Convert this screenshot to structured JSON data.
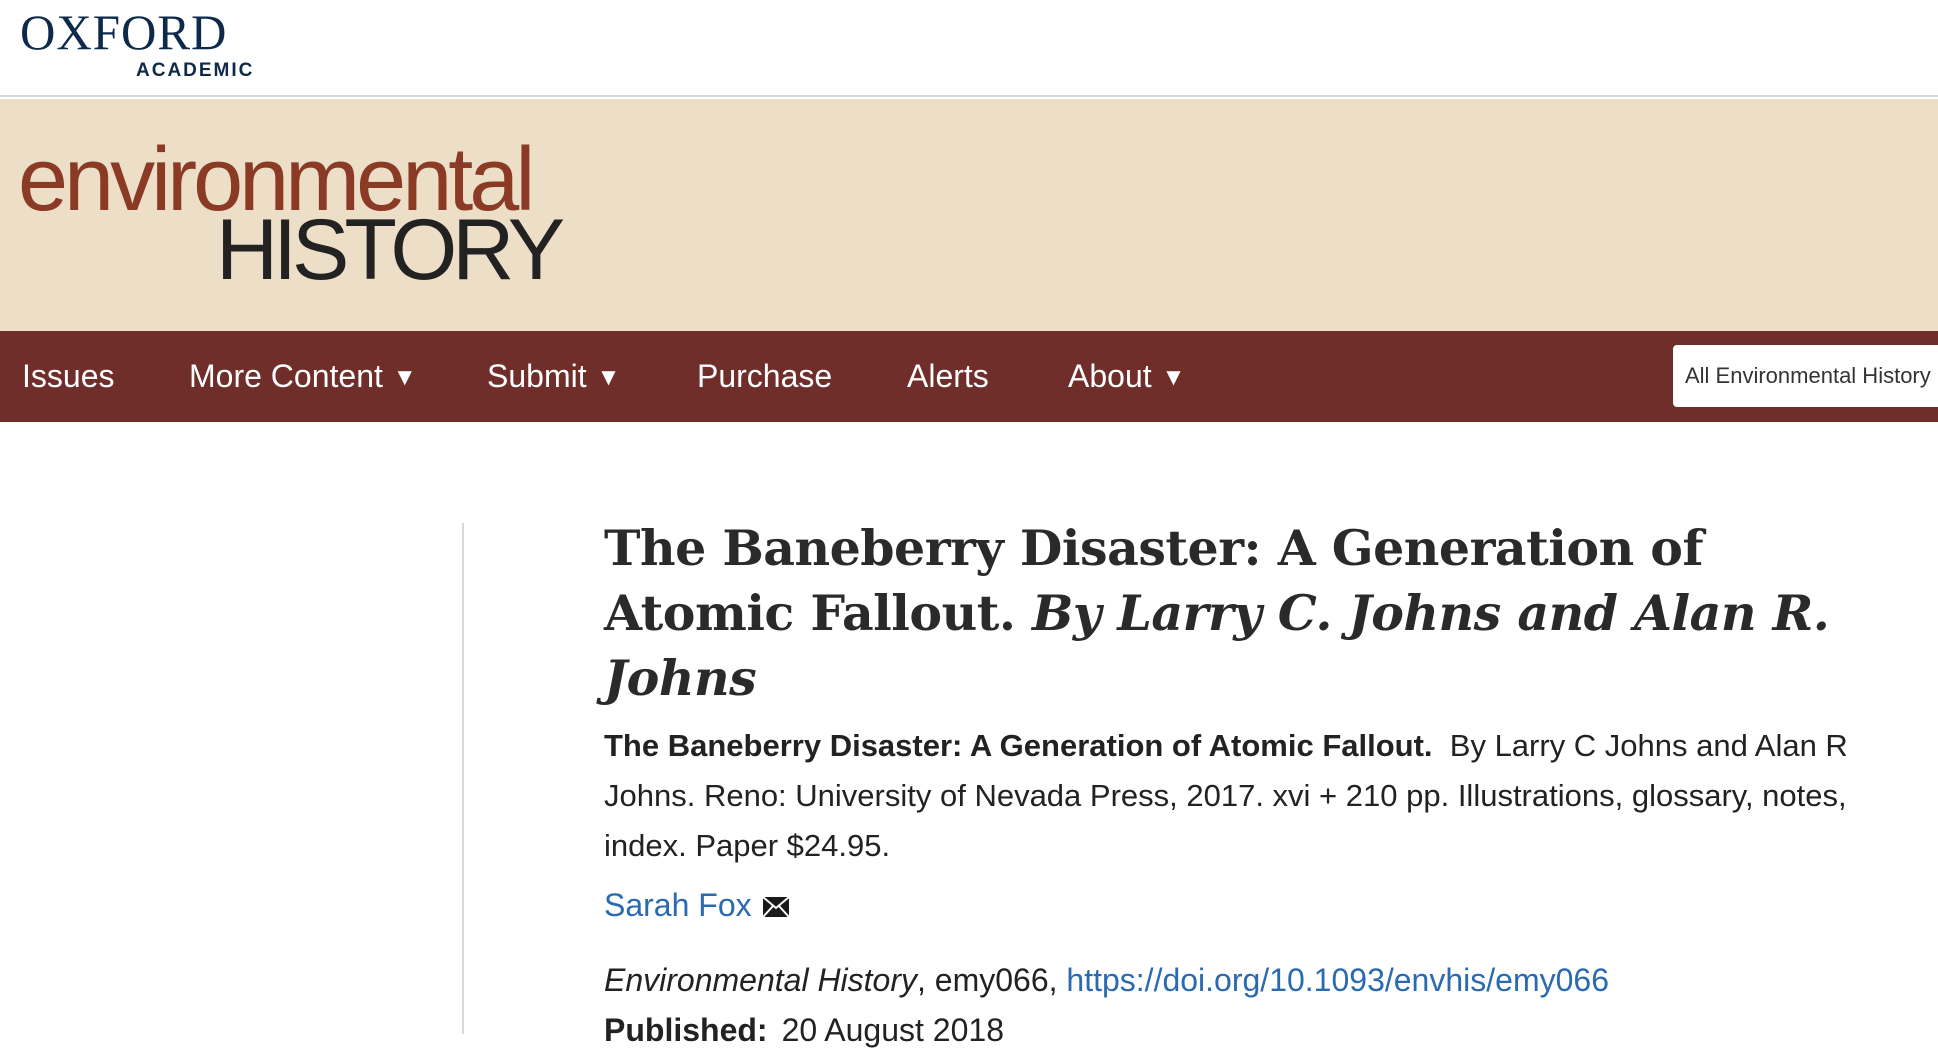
{
  "header": {
    "oxford_logo_word": "OXFORD",
    "oxford_logo_sub": "ACADEMIC"
  },
  "journal": {
    "logo_line_1": "environmental",
    "logo_line_2": "HISTORY"
  },
  "nav": {
    "items": [
      {
        "label": "Issues",
        "has_dropdown": false
      },
      {
        "label": "More Content",
        "has_dropdown": true
      },
      {
        "label": "Submit",
        "has_dropdown": true
      },
      {
        "label": "Purchase",
        "has_dropdown": false
      },
      {
        "label": "Alerts",
        "has_dropdown": false
      },
      {
        "label": "About",
        "has_dropdown": true
      }
    ],
    "caret": "▼",
    "search_scope_selected": "All Environmental History"
  },
  "article": {
    "title_main": "The Baneberry Disaster: A Generation of Atomic Fallout.",
    "title_byline": "By Larry C. Johns and Alan R. Johns",
    "book_title": "The Baneberry Disaster: A Generation of Atomic Fallout.",
    "book_details": "By Larry C Johns and Alan R Johns. Reno:  University of Nevada Press,  2017. xvi +  210 pp. Illustrations, glossary, notes, index. Paper $24.95.",
    "author_name": "Sarah Fox",
    "author_contact_icon": "envelope-icon",
    "journal_name": "Environmental History",
    "article_id": ", emy066, ",
    "doi": "https://doi.org/10.1093/envhis/emy066",
    "published_label": "Published:",
    "published_date": "20 August 2018"
  },
  "colors": {
    "oxford_navy": "#0e2a4b",
    "banner_bg": "#eddfc7",
    "logo_brown": "#8a3a25",
    "nav_bg": "#6f2e29",
    "link_blue": "#2a6ab0"
  }
}
